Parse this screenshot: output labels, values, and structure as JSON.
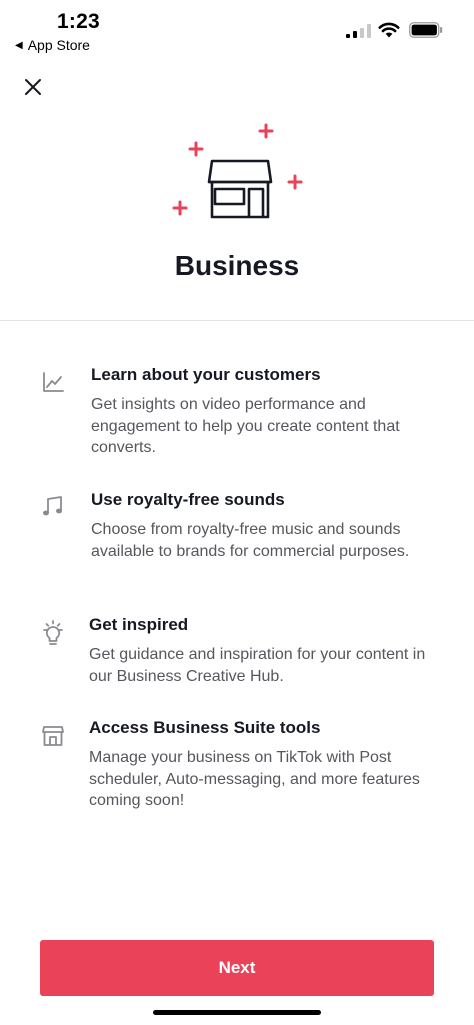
{
  "status_bar": {
    "time": "1:23",
    "back_app": "App Store"
  },
  "header": {
    "title": "Business"
  },
  "icons": {
    "close": "close-icon",
    "hero": "storefront-icon",
    "sparkle": "plus-sparkle-icon",
    "accent": "#ea4359"
  },
  "features": [
    {
      "icon": "chart-icon",
      "title": "Learn about your customers",
      "description": "Get insights on video performance and engagement to help you create content that converts."
    },
    {
      "icon": "music-note-icon",
      "title": "Use royalty-free sounds",
      "description": "Choose from royalty-free music and sounds available to brands for commercial purposes."
    },
    {
      "icon": "lightbulb-icon",
      "title": "Get inspired",
      "description": "Get guidance and inspiration for your content in our Business Creative Hub."
    },
    {
      "icon": "store-icon",
      "title": "Access Business Suite tools",
      "description": "Manage your business on TikTok with Post scheduler, Auto-messaging, and more features coming soon!"
    }
  ],
  "footer": {
    "next_label": "Next"
  }
}
